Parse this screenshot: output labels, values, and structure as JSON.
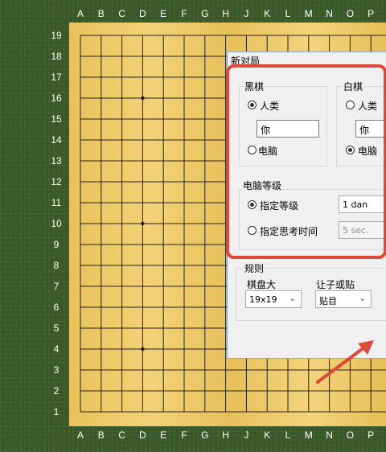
{
  "board": {
    "columns": [
      "A",
      "B",
      "C",
      "D",
      "E",
      "F",
      "G",
      "H",
      "J",
      "K",
      "L",
      "M",
      "N",
      "O",
      "P"
    ],
    "rows": [
      "19",
      "18",
      "17",
      "16",
      "15",
      "14",
      "13",
      "12",
      "11",
      "10",
      "9",
      "8",
      "7",
      "6",
      "5",
      "4",
      "3",
      "2",
      "1"
    ]
  },
  "dialog": {
    "title": "新对局",
    "black": {
      "title": "黑棋",
      "human": "人类",
      "name_value": "你",
      "computer": "电脑",
      "selected": "human"
    },
    "white": {
      "title": "白棋",
      "human": "人类",
      "name_value": "你",
      "computer": "电脑",
      "selected": "computer"
    },
    "level": {
      "title": "电脑等级",
      "fixed_label": "指定等级",
      "fixed_value": "1 dan",
      "time_label": "指定思考时间",
      "time_value": "5 sec.",
      "selected": "fixed"
    },
    "rules": {
      "title": "规则",
      "board_size_label": "棋盘大",
      "board_size_value": "19x19",
      "handicap_label": "让子或贴",
      "handicap_value": "贴目"
    }
  },
  "colors": {
    "highlight": "#e0493a",
    "board": "#eccb6a",
    "background": "#3b5c2a"
  }
}
